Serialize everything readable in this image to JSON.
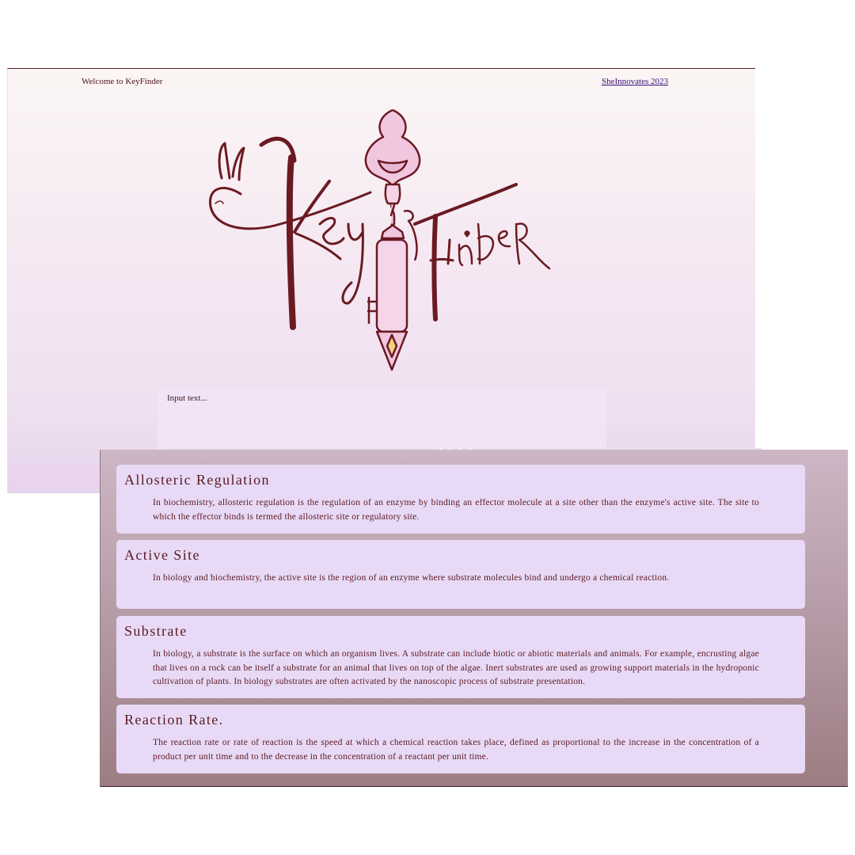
{
  "header": {
    "welcome": "Welcome to KeyFinder",
    "credit_link": "SheInnovates 2023"
  },
  "logo": {
    "alt": "KeyFinder logo with ornate key",
    "icon": "key-icon",
    "colors": {
      "ink": "#6b1a22",
      "key_pink": "#f1c6df",
      "gem": "#f3d27a"
    }
  },
  "search": {
    "placeholder": "Input text...",
    "value": ""
  },
  "results_tab": {
    "dots": "• • • •"
  },
  "definitions": [
    {
      "title": "Allosteric Regulation",
      "body": "In biochemistry, allosteric regulation is the regulation of an enzyme by binding an effector molecule at a site other than the enzyme's active site. The site to which the effector binds is termed the allosteric site or regulatory site."
    },
    {
      "title": "Active Site",
      "body": "In biology and biochemistry, the active site is the region of an enzyme where substrate molecules bind and undergo a chemical reaction."
    },
    {
      "title": "Substrate",
      "body": "In biology, a substrate is the surface on which an organism lives. A substrate can include biotic or abiotic materials and animals. For example, encrusting algae that lives on a rock can be itself a substrate for an animal that lives on top of the algae. Inert substrates are used as growing support materials in the hydroponic cultivation of plants. In biology substrates are often activated by the nanoscopic process of substrate presentation."
    },
    {
      "title": "Reaction Rate.",
      "body": "The reaction rate or rate of reaction is the speed at which a chemical reaction takes place, defined as proportional to the increase in the concentration of a product per unit time and to the decrease in the concentration of a reactant per unit time."
    }
  ],
  "colors": {
    "text": "#5a1a22",
    "card_bg": "#e8daf6",
    "link": "#3a0a7a"
  }
}
